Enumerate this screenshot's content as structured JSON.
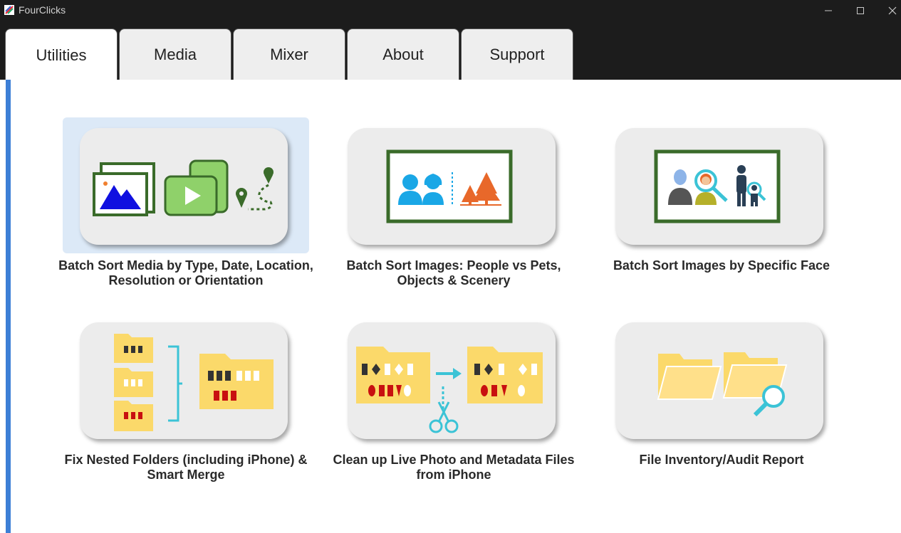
{
  "window": {
    "title": "FourClicks"
  },
  "tabs": [
    {
      "label": "Utilities",
      "active": true
    },
    {
      "label": "Media",
      "active": false
    },
    {
      "label": "Mixer",
      "active": false
    },
    {
      "label": "About",
      "active": false
    },
    {
      "label": "Support",
      "active": false
    }
  ],
  "colors": {
    "accent_bar": "#3d7fd6",
    "selected_tile": "#dce9f7",
    "card": "#ececec",
    "frame_green": "#3a6b2a",
    "folder_yellow": "#fbd96a",
    "teal": "#3bc3d6"
  },
  "utilities": [
    {
      "label_line1": "Batch Sort Media by Type, Date, Location,",
      "label_line2": "Resolution or Orientation",
      "icon": "media-sort-icon",
      "selected": true
    },
    {
      "label_line1": "Batch Sort Images: People vs Pets,",
      "label_line2": "Objects & Scenery",
      "icon": "people-scenery-icon",
      "selected": false
    },
    {
      "label_line1": "Batch Sort Images by Specific Face",
      "label_line2": "",
      "icon": "face-search-icon",
      "selected": false
    },
    {
      "label_line1": "Fix Nested Folders (including iPhone) &",
      "label_line2": "Smart Merge",
      "icon": "nested-folders-icon",
      "selected": false
    },
    {
      "label_line1": "Clean up Live Photo and Metadata Files",
      "label_line2": "from iPhone",
      "icon": "live-photo-cleanup-icon",
      "selected": false
    },
    {
      "label_line1": "File Inventory/Audit Report",
      "label_line2": "",
      "icon": "folder-audit-icon",
      "selected": false
    }
  ]
}
